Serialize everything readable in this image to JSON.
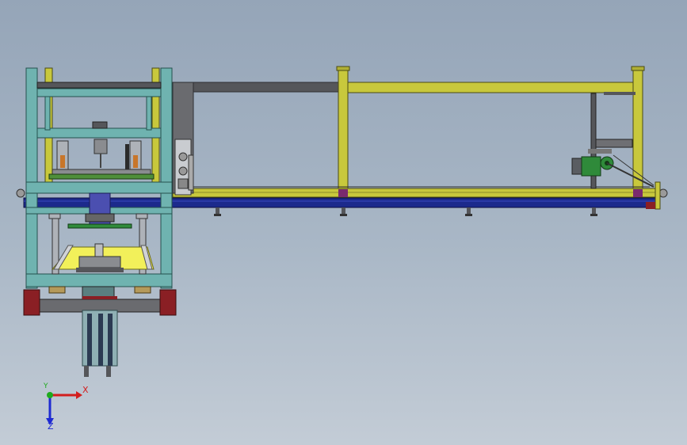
{
  "viewport": {
    "background_top": "#95a5b8",
    "background_bottom": "#c3ccd6"
  },
  "colors": {
    "frame_teal": "#6fb3b0",
    "frame_yellow": "#c8c83c",
    "frame_dark": "#55565a",
    "belt_blue": "#1c2a8c",
    "platen_yellow": "#f2f05a",
    "bracket_red": "#8a1f24",
    "motor_green": "#2f8a3a",
    "cylinder_purple": "#4b4fb0"
  },
  "triad": {
    "x_label": "X",
    "y_label": "Y",
    "z_label": "Z",
    "x_color": "#d21e1e",
    "y_color": "#1eaa1e",
    "z_color": "#1e2ad2"
  }
}
